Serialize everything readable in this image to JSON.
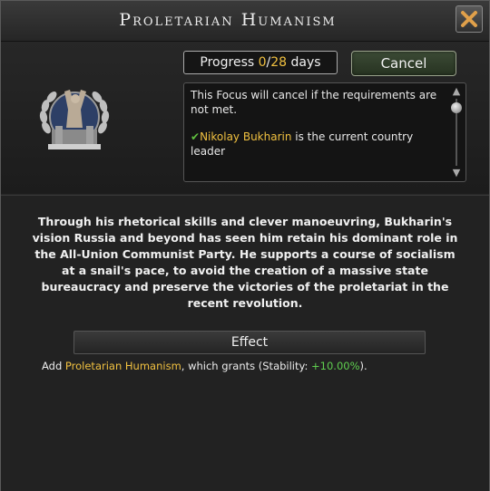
{
  "window": {
    "title": "Proletarian Humanism",
    "close_icon": "close-x-icon"
  },
  "focus": {
    "emblem_icon": "worker-statue-emblem-icon",
    "progress_prefix": "Progress ",
    "progress_current": "0",
    "progress_separator": "/",
    "progress_total": "28",
    "progress_suffix": " days",
    "cancel_label": "Cancel"
  },
  "requirements": {
    "intro": "This Focus will cancel if the requirements are not met.",
    "check_mark": "✔",
    "leader_name": "Nikolay Bukharin",
    "leader_text": " is the current country leader"
  },
  "description": "Through his rhetorical skills and clever manoeuvring, Bukharin's vision Russia and beyond has seen him retain his dominant role in the All-Union Communist Party. He supports a course of socialism at a snail's pace, to avoid the creation of a massive state bureaucracy and preserve the victories of the proletariat in the recent revolution.",
  "effect": {
    "header": "Effect",
    "prefix": "Add ",
    "spirit_name": "Proletarian Humanism",
    "middle": ", which grants (Stability: ",
    "value": "+10.00%",
    "suffix": ")."
  },
  "colors": {
    "highlight_yellow": "#f0c040",
    "positive_green": "#5fcf4f",
    "cancel_button": "#2f3d29"
  }
}
